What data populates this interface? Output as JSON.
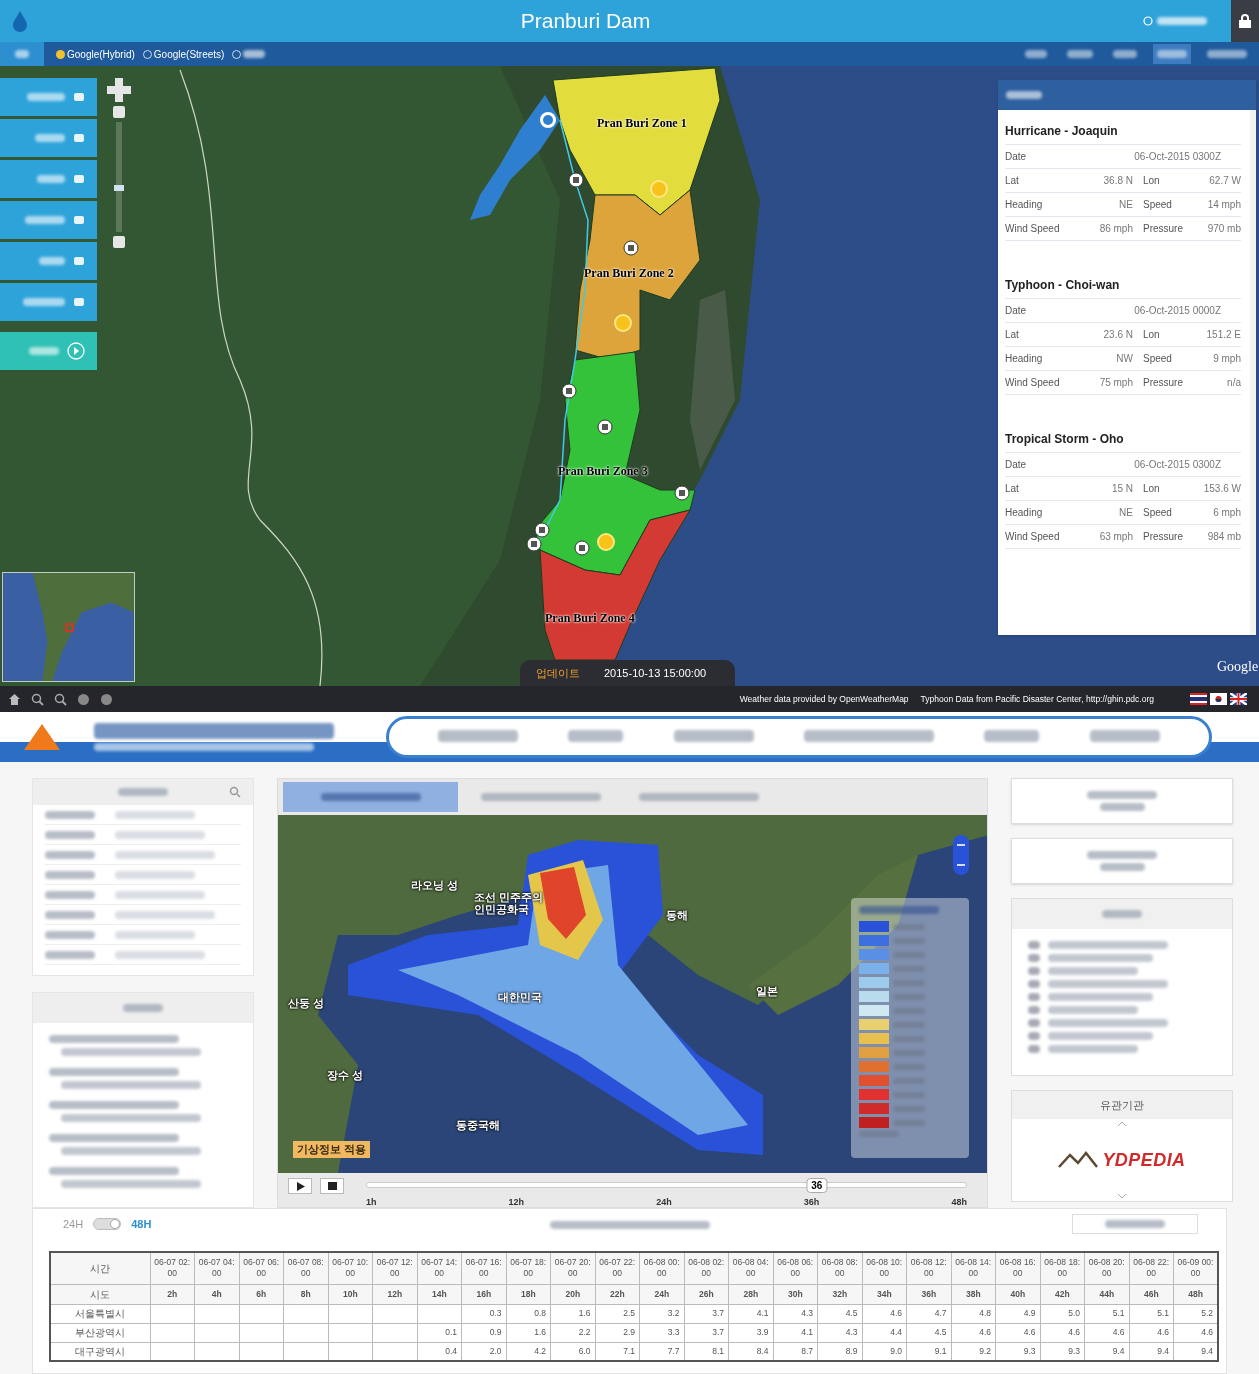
{
  "app_header": {
    "title": "Pranburi Dam"
  },
  "map_layers": [
    {
      "label": "Google(Hybrid)",
      "selected": true
    },
    {
      "label": "Google(Streets)",
      "selected": false
    },
    {
      "selected": false
    }
  ],
  "top_menu_tabs": [
    {
      "selected": false
    },
    {
      "selected": false
    },
    {
      "selected": false
    },
    {
      "selected": true
    },
    {
      "selected": false
    }
  ],
  "map_zoom": {
    "level": 0.39
  },
  "zones": [
    {
      "label": "Pran Buri Zone 1",
      "color": "#e2dc3c"
    },
    {
      "label": "Pran Buri Zone 2",
      "color": "#dca43a"
    },
    {
      "label": "Pran Buri Zone 3",
      "color": "#34c23a"
    },
    {
      "label": "Pran Buri Zone 4",
      "color": "#d33a34"
    }
  ],
  "update": {
    "label": "업데이트",
    "time": "2015-10-13 15:00:00"
  },
  "map_brand": "Google",
  "credits": [
    "Weather data provided by OpenWeatherMap",
    "Typhoon Data from Pacific Disaster Center, http://ghin.pdc.org"
  ],
  "storms": [
    {
      "name": "Hurricane - Joaquin",
      "rows": [
        {
          "label": "Date",
          "value": "06-Oct-2015 0300Z"
        },
        {
          "label": "Lat",
          "value": "36.8 N",
          "label_2": "Lon",
          "value_2": "62.7 W"
        },
        {
          "label": "Heading",
          "value": "NE",
          "label_2": "Speed",
          "value_2": "14 mph"
        },
        {
          "label": "Wind Speed",
          "value": "86 mph",
          "label_2": "Pressure",
          "value_2": "970 mb"
        }
      ]
    },
    {
      "name": "Typhoon - Choi-wan",
      "rows": [
        {
          "label": "Date",
          "value": "06-Oct-2015 0000Z"
        },
        {
          "label": "Lat",
          "value": "23.6 N",
          "label_2": "Lon",
          "value_2": "151.2 E"
        },
        {
          "label": "Heading",
          "value": "NW",
          "label_2": "Speed",
          "value_2": "9 mph"
        },
        {
          "label": "Wind Speed",
          "value": "75 mph",
          "label_2": "Pressure",
          "value_2": "n/a"
        }
      ]
    },
    {
      "name": "Tropical Storm - Oho",
      "rows": [
        {
          "label": "Date",
          "value": "06-Oct-2015 0300Z"
        },
        {
          "label": "Lat",
          "value": "15 N",
          "label_2": "Lon",
          "value_2": "153.6 W"
        },
        {
          "label": "Heading",
          "value": "NE",
          "label_2": "Speed",
          "value_2": "6 mph"
        },
        {
          "label": "Wind Speed",
          "value": "63 mph",
          "label_2": "Pressure",
          "value_2": "984 mb"
        }
      ]
    }
  ],
  "dispersion_tabs": [
    {
      "selected": true
    },
    {
      "selected": false
    },
    {
      "selected": false
    }
  ],
  "dispersion_map": {
    "labels": [
      "라오닝 성",
      "조선 민주주의 인민공화국",
      "동해",
      "대한민국",
      "일본",
      "산둥 성",
      "장수 성",
      "동중국해"
    ],
    "badge": "기상정보 적용",
    "playback": {
      "level": 0.75,
      "reading": "36",
      "ticks": [
        "1h",
        "12h",
        "24h",
        "36h",
        "48h"
      ]
    }
  },
  "agency": {
    "title": "유관기관",
    "logo": "YDPEDIA"
  },
  "range_toggle": [
    {
      "label": "24H",
      "selected": false
    },
    {
      "label": "48H",
      "selected": true
    }
  ],
  "table": {
    "corner_1": "시간",
    "corner_2": "시도",
    "times": [
      "06-07 02:00",
      "06-07 04:00",
      "06-07 06:00",
      "06-07 08:00",
      "06-07 10:00",
      "06-07 12:00",
      "06-07 14:00",
      "06-07 16:00",
      "06-07 18:00",
      "06-07 20:00",
      "06-07 22:00",
      "06-08 00:00",
      "06-08 02:00",
      "06-08 04:00",
      "06-08 06:00",
      "06-08 08:00",
      "06-08 10:00",
      "06-08 12:00",
      "06-08 14:00",
      "06-08 16:00",
      "06-08 18:00",
      "06-08 20:00",
      "06-08 22:00",
      "06-09 00:00"
    ],
    "hours": [
      "2h",
      "4h",
      "6h",
      "8h",
      "10h",
      "12h",
      "14h",
      "16h",
      "18h",
      "20h",
      "22h",
      "24h",
      "26h",
      "28h",
      "30h",
      "32h",
      "34h",
      "36h",
      "38h",
      "40h",
      "42h",
      "44h",
      "46h",
      "48h"
    ],
    "rows": [
      {
        "name": "서울특별시",
        "values": [
          "0.3",
          "0.8",
          "1.6",
          "2.5",
          "3.2",
          "3.7",
          "4.1",
          "4.3",
          "4.5",
          "4.6",
          "4.7",
          "4.8",
          "4.9",
          "5.0",
          "5.1",
          "5.1",
          "5.2"
        ]
      },
      {
        "name": "부산광역시",
        "values": [
          "0.1",
          "0.9",
          "1.6",
          "2.2",
          "2.9",
          "3.3",
          "3.7",
          "3.9",
          "4.1",
          "4.3",
          "4.4",
          "4.5",
          "4.6",
          "4.6",
          "4.6",
          "4.6",
          "4.6",
          "4.6"
        ]
      },
      {
        "name": "대구광역시",
        "values": [
          "0.4",
          "2.0",
          "4.2",
          "6.0",
          "7.1",
          "7.7",
          "8.1",
          "8.4",
          "8.7",
          "8.9",
          "9.0",
          "9.1",
          "9.2",
          "9.3",
          "9.3",
          "9.4",
          "9.4",
          "9.4"
        ]
      }
    ]
  }
}
